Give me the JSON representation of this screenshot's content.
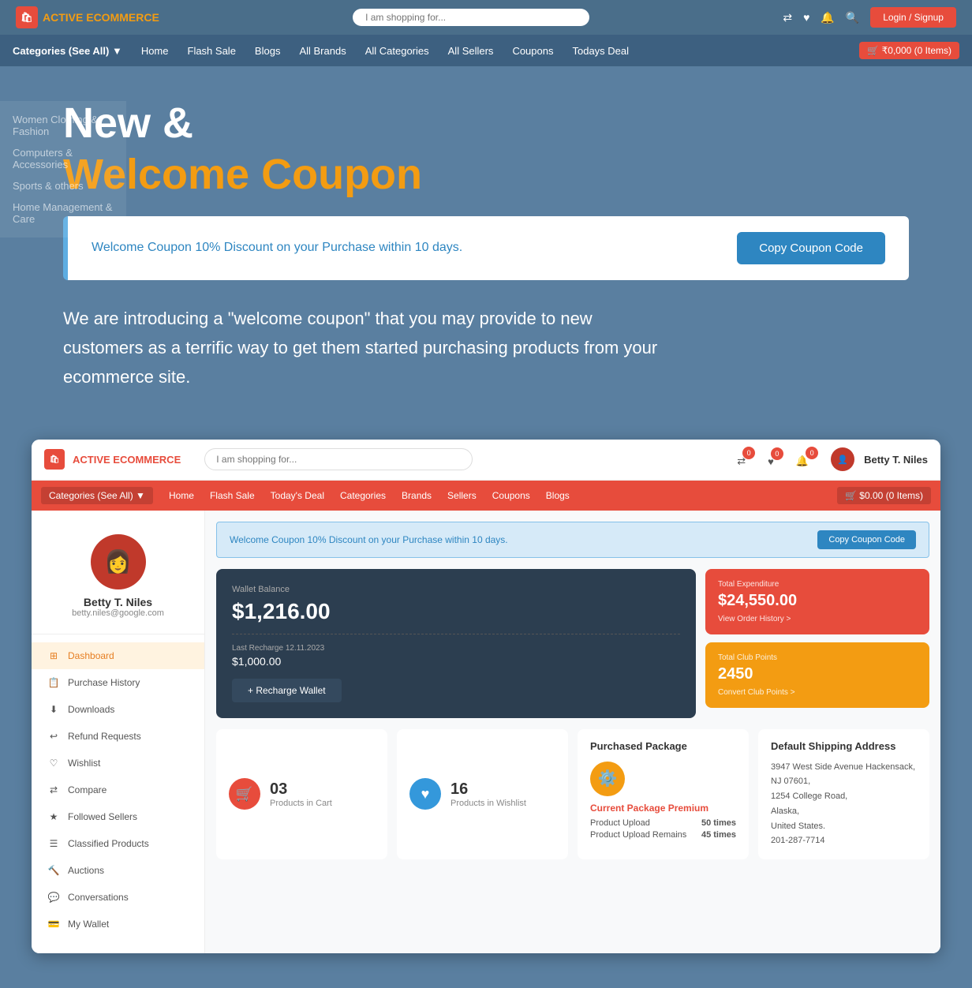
{
  "outer": {
    "topbar": {
      "logo_text": "ACTIVE",
      "logo_text2": "ECOMMERCE",
      "search_placeholder": "I am shopping for...",
      "nav_items": [
        "Home",
        "Flash Sale",
        "Blogs",
        "All Brands",
        "All Categories",
        "All Sellers",
        "Coupons",
        "Todays Deal"
      ],
      "cart_label": "₹0,000",
      "cart_items": "(0 Items)"
    },
    "hero": {
      "line1": "New &",
      "line2": "Welcome Coupon"
    },
    "coupon_banner": {
      "text": "Welcome Coupon 10% Discount on your Purchase within 10 days.",
      "button": "Copy Coupon Code"
    },
    "description": "We are introducing a \"welcome coupon\" that you may provide to new customers as a terrific way to get them started purchasing products from your ecommerce site."
  },
  "sidebar_faded": {
    "items": [
      "Women Clothing & Fashion",
      "Computers & Accessories",
      "Sports & others",
      "Home Management & Care"
    ]
  },
  "inner": {
    "topbar": {
      "logo_text1": "ACTIVE",
      "logo_text2": "ECOMMERCE",
      "search_placeholder": "I am shopping for...",
      "user_name": "Betty T. Niles",
      "badge1": "0",
      "badge2": "0",
      "badge3": "0"
    },
    "catbar": {
      "items": [
        "Categories (See All)",
        "Home",
        "Flash Sale",
        "Today's Deal",
        "Categories",
        "Brands",
        "Sellers",
        "Coupons",
        "Blogs"
      ],
      "cart": "$0.00 (0 Items)"
    },
    "coupon_banner": {
      "text": "Welcome Coupon 10% Discount on your Purchase within 10 days.",
      "button": "Copy Coupon Code"
    },
    "sidebar": {
      "user_name": "Betty T. Niles",
      "user_email": "betty.niles@google.com",
      "menu": [
        {
          "label": "Dashboard",
          "active": true
        },
        {
          "label": "Purchase History",
          "active": false
        },
        {
          "label": "Downloads",
          "active": false
        },
        {
          "label": "Refund Requests",
          "active": false
        },
        {
          "label": "Wishlist",
          "active": false
        },
        {
          "label": "Compare",
          "active": false
        },
        {
          "label": "Followed Sellers",
          "active": false
        },
        {
          "label": "Classified Products",
          "active": false
        },
        {
          "label": "Auctions",
          "active": false
        },
        {
          "label": "Conversations",
          "active": false
        },
        {
          "label": "My Wallet",
          "active": false
        }
      ]
    },
    "wallet": {
      "label": "Wallet Balance",
      "balance": "$1,216.00",
      "recharge_label": "Last Recharge  12.11.2023",
      "recharge_amount": "$1,000.00",
      "recharge_button": "+ Recharge Wallet"
    },
    "total_expenditure": {
      "label": "Total Expenditure",
      "value": "$24,550.00",
      "link": "View Order History  >"
    },
    "total_club_points": {
      "label": "Total Club Points",
      "value": "2450",
      "link": "Convert Club Points  >"
    },
    "cart_stat": {
      "value": "03",
      "label": "Products in Cart"
    },
    "wishlist_stat": {
      "value": "16",
      "label": "Products in Wishlist"
    },
    "package": {
      "title": "Purchased Package",
      "name": "Current Package Premium",
      "product_upload": "Product Upload",
      "product_upload_value": "50 times",
      "product_upload_remains": "Product Upload Remains",
      "product_upload_remains_value": "45 times"
    },
    "shipping": {
      "title": "Default Shipping Address",
      "address": "3947 West Side Avenue Hackensack, NJ 07601,\n1254 College Road,\nAlaska,\nUnited States.\n201-287-7714"
    }
  }
}
